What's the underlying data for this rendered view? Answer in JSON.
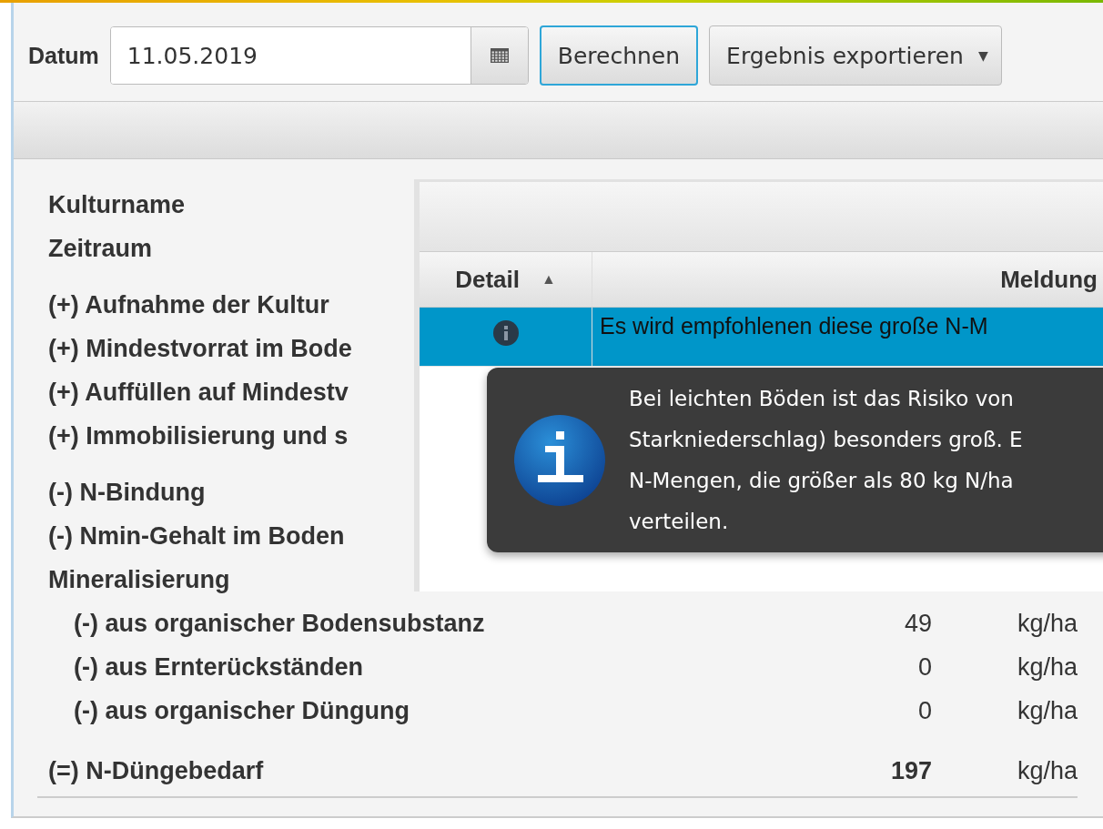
{
  "toolbar": {
    "date_label": "Datum",
    "date_value": "11.05.2019",
    "calculate_button": {
      "label": "Berechnen",
      "focused": true
    },
    "export_button": {
      "label": "Ergebnis exportieren",
      "caret": "▼"
    }
  },
  "summary": {
    "header_rows": [
      {
        "label": "Kulturname"
      },
      {
        "label": "Zeitraum"
      }
    ],
    "groups": [
      [
        {
          "label": "(+) Aufnahme der Kultur"
        },
        {
          "label": "(+) Mindestvorrat im Bode"
        },
        {
          "label": "(+) Auffüllen auf Mindestv"
        },
        {
          "label": "(+) Immobilisierung und s"
        }
      ],
      [
        {
          "label": "(-) N-Bindung"
        },
        {
          "label": "(-) Nmin-Gehalt im Boden"
        },
        {
          "label": "Mineralisierung"
        },
        {
          "label": "(-) aus organischer Bodensubstanz",
          "indented": true,
          "value": "49",
          "unit": "kg/ha"
        },
        {
          "label": "(-) aus Ernterückständen",
          "indented": true,
          "value": "0",
          "unit": "kg/ha"
        },
        {
          "label": "(-) aus organischer Düngung",
          "indented": true,
          "value": "0",
          "unit": "kg/ha"
        }
      ]
    ],
    "total": {
      "label": "(=) N-Düngebedarf",
      "value": "197",
      "unit": "kg/ha"
    }
  },
  "messages_table": {
    "columns": [
      {
        "label": "Detail",
        "sort": "▲"
      },
      {
        "label": "Meldung"
      }
    ],
    "rows": [
      {
        "selected": true,
        "detail_icon": true,
        "message": "Es wird empfohlenen diese große N-M"
      }
    ]
  },
  "tooltip": {
    "text": "Bei leichten Böden ist das Risiko von\nStarkniederschlag) besonders groß. E\nN-Mengen, die größer als 80 kg N/ha\nverteilen."
  }
}
